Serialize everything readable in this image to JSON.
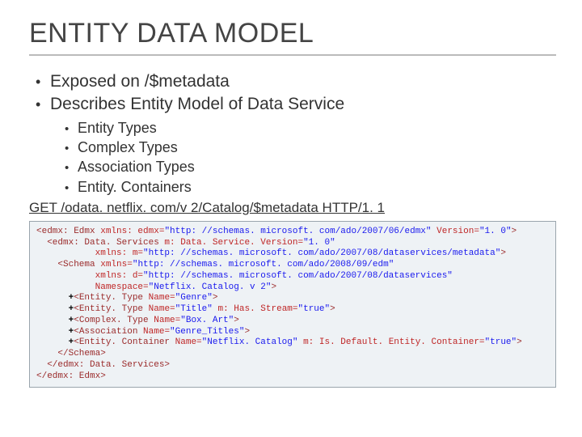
{
  "title": "ENTITY DATA MODEL",
  "bullets": [
    "Exposed on /$metadata",
    "Describes Entity Model of Data Service"
  ],
  "subbullets": [
    "Entity Types",
    "Complex Types",
    "Association Types",
    "Entity. Containers"
  ],
  "get_line": "GET /odata. netflix. com/v 2/Catalog/$metadata HTTP/1. 1",
  "code": {
    "l1_tag": "<edmx: Edmx",
    "l1_a1n": " xmlns: edmx=",
    "l1_a1v": "\"http: //schemas. microsoft. com/ado/2007/06/edmx\"",
    "l1_a2n": " Version=",
    "l1_a2v": "\"1. 0\"",
    "l1_end": ">",
    "l2_tag": "  <edmx: Data. Services",
    "l2_a1n": " m: Data. Service. Version=",
    "l2_a1v": "\"1. 0\"",
    "l3_a1n": "           xmlns: m=",
    "l3_a1v": "\"http: //schemas. microsoft. com/ado/2007/08/dataservices/metadata\"",
    "l3_end": ">",
    "l4_tag": "    <Schema",
    "l4_a1n": " xmlns=",
    "l4_a1v": "\"http: //schemas. microsoft. com/ado/2008/09/edm\"",
    "l5_a1n": "           xmlns: d=",
    "l5_a1v": "\"http: //schemas. microsoft. com/ado/2007/08/dataservices\"",
    "l6_a1n": "           Namespace=",
    "l6_a1v": "\"Netflix. Catalog. v 2\"",
    "l6_end": ">",
    "l7_pre": "      +",
    "l7_tag": "<Entity. Type",
    "l7_a1n": " Name=",
    "l7_a1v": "\"Genre\"",
    "l7_end": ">",
    "l8_pre": "      +",
    "l8_tag": "<Entity. Type",
    "l8_a1n": " Name=",
    "l8_a1v": "\"Title\"",
    "l8_a2n": " m: Has. Stream=",
    "l8_a2v": "\"true\"",
    "l8_end": ">",
    "l9_pre": "      +",
    "l9_tag": "<Complex. Type",
    "l9_a1n": " Name=",
    "l9_a1v": "\"Box. Art\"",
    "l9_end": ">",
    "l10_pre": "      +",
    "l10_tag": "<Association",
    "l10_a1n": " Name=",
    "l10_a1v": "\"Genre_Titles\"",
    "l10_end": ">",
    "l11_pre": "      +",
    "l11_tag": "<Entity. Container",
    "l11_a1n": " Name=",
    "l11_a1v": "\"Netflix. Catalog\"",
    "l11_a2n": " m: Is. Default. Entity. Container=",
    "l11_a2v": "\"true\"",
    "l11_end": ">",
    "l12": "    </Schema>",
    "l13": "  </edmx: Data. Services>",
    "l14": "</edmx: Edmx>"
  }
}
